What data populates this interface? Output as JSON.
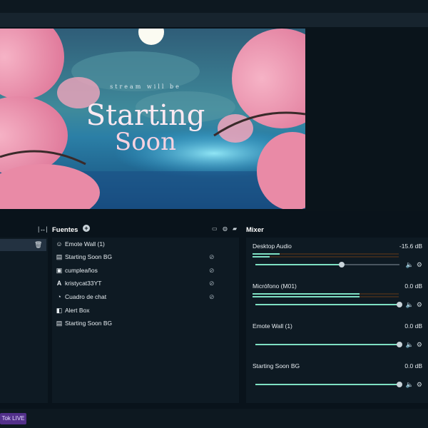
{
  "preview": {
    "subtitle": "stream will be",
    "title_line1": "Starting",
    "title_line2": "Soon"
  },
  "sources": {
    "title": "Fuentes",
    "items": [
      {
        "label": "Emote Wall (1)",
        "icon": "emote-icon",
        "vis": false
      },
      {
        "label": "Starting Soon BG",
        "icon": "file-icon",
        "vis": true
      },
      {
        "label": "cumpleaños",
        "icon": "image-icon",
        "vis": true
      },
      {
        "label": "kristycat33YT",
        "icon": "text-icon",
        "vis": true
      },
      {
        "label": "Cuadro de chat",
        "icon": "chat-icon",
        "vis": true
      },
      {
        "label": "Alert Box",
        "icon": "alertbox-icon",
        "vis": false
      },
      {
        "label": "Starting Soon BG",
        "icon": "file-icon",
        "vis": false
      }
    ]
  },
  "mixer": {
    "title": "Mixer",
    "channels": [
      {
        "name": "Desktop Audio",
        "db": "-15.6 dB",
        "level": 0.6
      },
      {
        "name": "Micrófono (M01)",
        "db": "0.0 dB",
        "level": 1.0
      },
      {
        "name": "Emote Wall (1)",
        "db": "0.0 dB",
        "level": 1.0
      },
      {
        "name": "Starting Soon BG",
        "db": "0.0 dB",
        "level": 1.0
      }
    ]
  },
  "footer": {
    "tiktok_label": "Tok LIVE"
  },
  "colors": {
    "accent": "#7ee0c3",
    "panel": "#0e1a23",
    "background": "#09131b",
    "badge": "#52308a"
  }
}
